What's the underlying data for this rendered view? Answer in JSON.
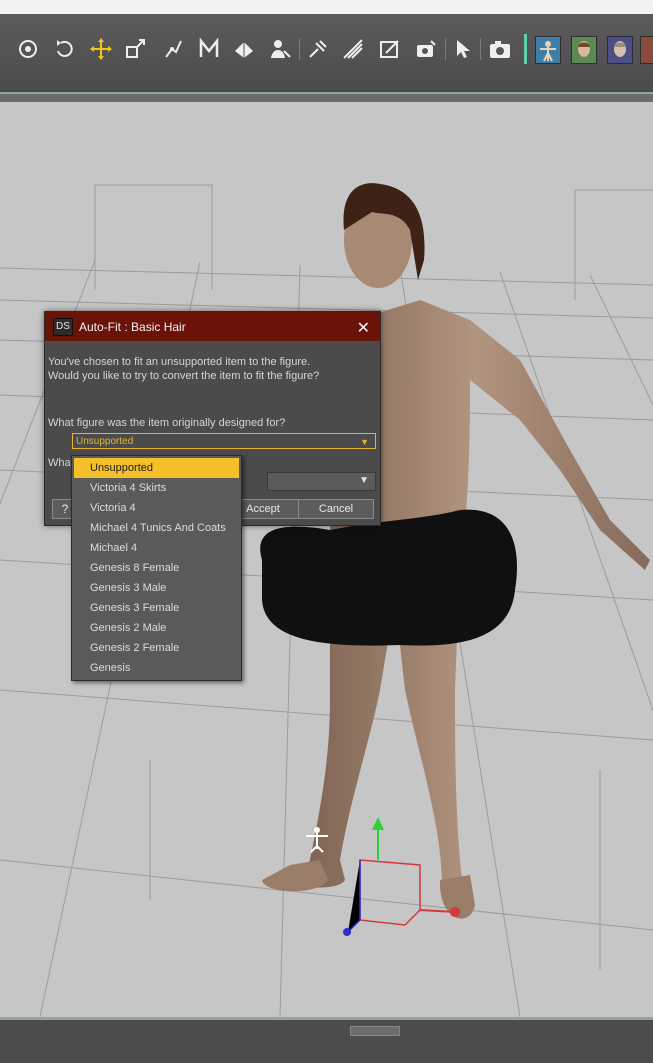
{
  "toolbar": {
    "tools": [
      {
        "name": "orbit-tool-icon"
      },
      {
        "name": "rotate-tool-icon"
      },
      {
        "name": "universal-translate-tool-icon"
      },
      {
        "name": "scale-tool-icon"
      },
      {
        "name": "joint-editor-tool-icon"
      },
      {
        "name": "morph-tool-icon"
      },
      {
        "name": "surface-selection-tool-icon"
      },
      {
        "name": "figure-tool-icon"
      },
      {
        "name": "geometry-editor-icon"
      },
      {
        "name": "spot-render-tool-icon"
      },
      {
        "name": "region-navigator-icon"
      },
      {
        "name": "camera-tool-icon"
      },
      {
        "name": "pointer-tool-icon"
      },
      {
        "name": "render-camera-icon"
      }
    ],
    "thumbnails": [
      {
        "name": "figure-thumbnail-1",
        "color": "#3f7fa7"
      },
      {
        "name": "figure-thumbnail-2",
        "color": "#5d8a52"
      },
      {
        "name": "figure-thumbnail-3",
        "color": "#4a4f86"
      },
      {
        "name": "figure-thumbnail-4",
        "color": "#8a4b3c"
      }
    ]
  },
  "dialog": {
    "logo": "DS",
    "title": "Auto-Fit : Basic Hair",
    "close_glyph": "✕",
    "message_line1": "You've chosen to fit an unsupported item to the figure.",
    "message_line2": "Would you like to try to convert the item to fit the figure?",
    "question1": "What figure was the item originally designed for?",
    "combo1_value": "Unsupported",
    "question2_partial": "What",
    "help_glyph": "?",
    "accept_label": "Accept",
    "cancel_label": "Cancel",
    "arrow_glyph": "▼"
  },
  "dropdown": {
    "options": [
      "Unsupported",
      "Victoria 4 Skirts",
      "Victoria 4",
      "Michael 4 Tunics And Coats",
      "Michael 4",
      "Genesis 8 Female",
      "Genesis 3 Male",
      "Genesis 3 Female",
      "Genesis 2 Male",
      "Genesis 2 Female",
      "Genesis"
    ],
    "selected_index": 0
  },
  "colors": {
    "title_bar": "#6b1308",
    "highlight": "#f5bf2a",
    "skin": "#a98b74",
    "hair_object": "#101010"
  }
}
